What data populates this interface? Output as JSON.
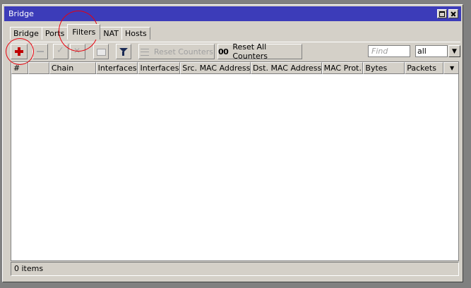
{
  "window": {
    "title": "Bridge"
  },
  "tabs": [
    "Bridge",
    "Ports",
    "Filters",
    "NAT",
    "Hosts"
  ],
  "toolbar": {
    "reset_counters": "Reset Counters",
    "reset_all_counters": "Reset All Counters",
    "find_placeholder": "Find",
    "filter_value": "all"
  },
  "table": {
    "columns": [
      "#",
      "Chain",
      "Interfaces...",
      "Interfaces...",
      "Src. MAC Address...",
      "Dst. MAC Address...",
      "MAC Prot...",
      "Bytes",
      "Packets"
    ]
  },
  "status": {
    "items": "0 items"
  },
  "colors": {
    "titlebar": "#3c3cb9",
    "annotation": "#e8000c",
    "add_icon": "#c00000"
  }
}
